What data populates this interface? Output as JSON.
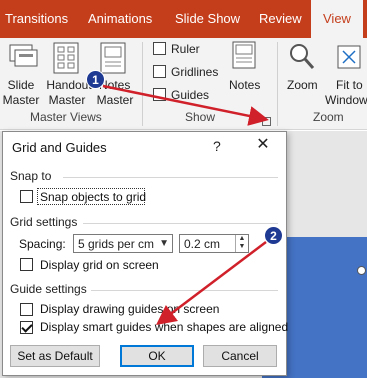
{
  "ribbon": {
    "tabs": [
      {
        "label": "Transitions"
      },
      {
        "label": "Animations"
      },
      {
        "label": "Slide Show"
      },
      {
        "label": "Review"
      },
      {
        "label": "View",
        "active": true
      }
    ],
    "buttons": {
      "slide_master": [
        "Slide",
        "Master"
      ],
      "handout_master": [
        "Handout",
        "Master"
      ],
      "notes_master": [
        "Notes",
        "Master"
      ],
      "notes": "Notes",
      "zoom": "Zoom",
      "fit_to_window": [
        "Fit to",
        "Window"
      ]
    },
    "show_checkboxes": [
      "Ruler",
      "Gridlines",
      "Guides"
    ],
    "groups": {
      "master_views": "Master Views",
      "show": "Show",
      "zoom": "Zoom"
    },
    "accent_color": "#c43e1c"
  },
  "dialog": {
    "title": "Grid and Guides",
    "help": "?",
    "close": "✕",
    "snap_section": "Snap to",
    "snap_objects": {
      "label": "Snap objects to grid",
      "checked": false
    },
    "grid_section": "Grid settings",
    "spacing_label": "Spacing:",
    "spacing_value": "5 grids per cm",
    "spacing_number": "0.2 cm",
    "display_grid": {
      "label": "Display grid on screen",
      "checked": false
    },
    "guide_section": "Guide settings",
    "display_drawing_guides": {
      "label": "Display drawing guides on screen",
      "checked": false
    },
    "display_smart_guides": {
      "label": "Display smart guides when shapes are aligned",
      "checked": true
    },
    "set_default": "Set as Default",
    "ok": "OK",
    "cancel": "Cancel"
  },
  "annotations": [
    {
      "number": "1",
      "color": "#1f3a93"
    },
    {
      "number": "2",
      "color": "#1f3a93"
    }
  ],
  "arrow_color": "#d0202a",
  "slide_color": "#4472c4"
}
